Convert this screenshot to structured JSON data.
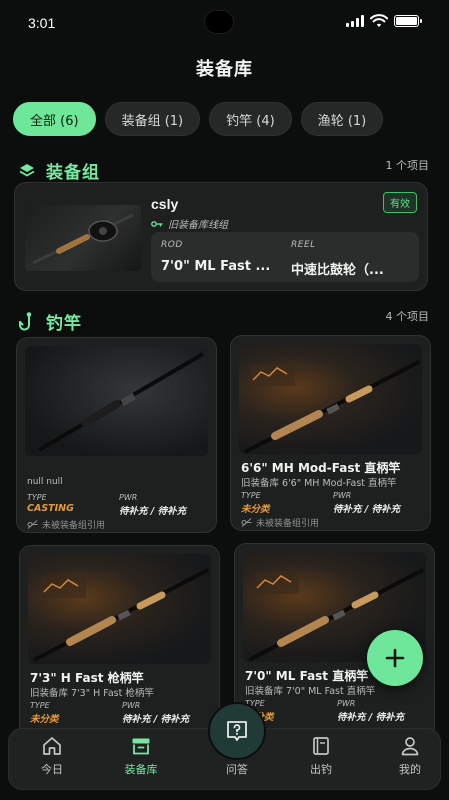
{
  "status": {
    "time": "3:01"
  },
  "header": {
    "title": "装备库"
  },
  "filters": [
    {
      "label": "全部 (6)",
      "active": true
    },
    {
      "label": "装备组 (1)",
      "active": false
    },
    {
      "label": "钓竿 (4)",
      "active": false
    },
    {
      "label": "渔轮 (1)",
      "active": false
    }
  ],
  "kits_section": {
    "title": "装备组",
    "count": "1 个项目"
  },
  "kit": {
    "name": "csly",
    "subtitle": "旧装备库线组",
    "badge": "有效",
    "rod_label": "ROD",
    "rod_value": "7'0\" ML Fast ...",
    "reel_label": "REEL",
    "reel_value": "中速比鼓轮（..."
  },
  "rods_section": {
    "title": "钓竿",
    "count": "4 个项目"
  },
  "rods": [
    {
      "title": "",
      "subtitle": "",
      "null_text": "null null",
      "type_label": "TYPE",
      "type_value": "CASTING",
      "pwr_label": "PWR",
      "pwr_value": "待补充 / 待补充",
      "unused": "未被装备组引用"
    },
    {
      "title": "6'6\" MH Mod-Fast 直柄竿",
      "subtitle": "旧装备库 6'6\" MH Mod-Fast 直柄竿",
      "type_label": "TYPE",
      "type_value": "未分类",
      "pwr_label": "PWR",
      "pwr_value": "待补充 / 待补充",
      "unused": "未被装备组引用"
    },
    {
      "title": "7'3\" H Fast 枪柄竿",
      "subtitle": "旧装备库 7'3\" H Fast 枪柄竿",
      "type_label": "TYPE",
      "type_value": "未分类",
      "pwr_label": "PWR",
      "pwr_value": "待补充 / 待补充"
    },
    {
      "title": "7'0\" ML Fast 直柄竿",
      "subtitle": "旧装备库 7'0\" ML Fast 直柄竿",
      "type_label": "TYPE",
      "type_value": "未分类",
      "pwr_label": "PWR",
      "pwr_value": "待补充 / 待补充"
    }
  ],
  "nav": {
    "today": "今日",
    "library": "装备库",
    "qa": "问答",
    "trip": "出钓",
    "me": "我的"
  },
  "colors": {
    "accent": "#6ee79a",
    "warning": "#e59a3a",
    "background": "#0c0e0d",
    "card": "#1e201f"
  }
}
